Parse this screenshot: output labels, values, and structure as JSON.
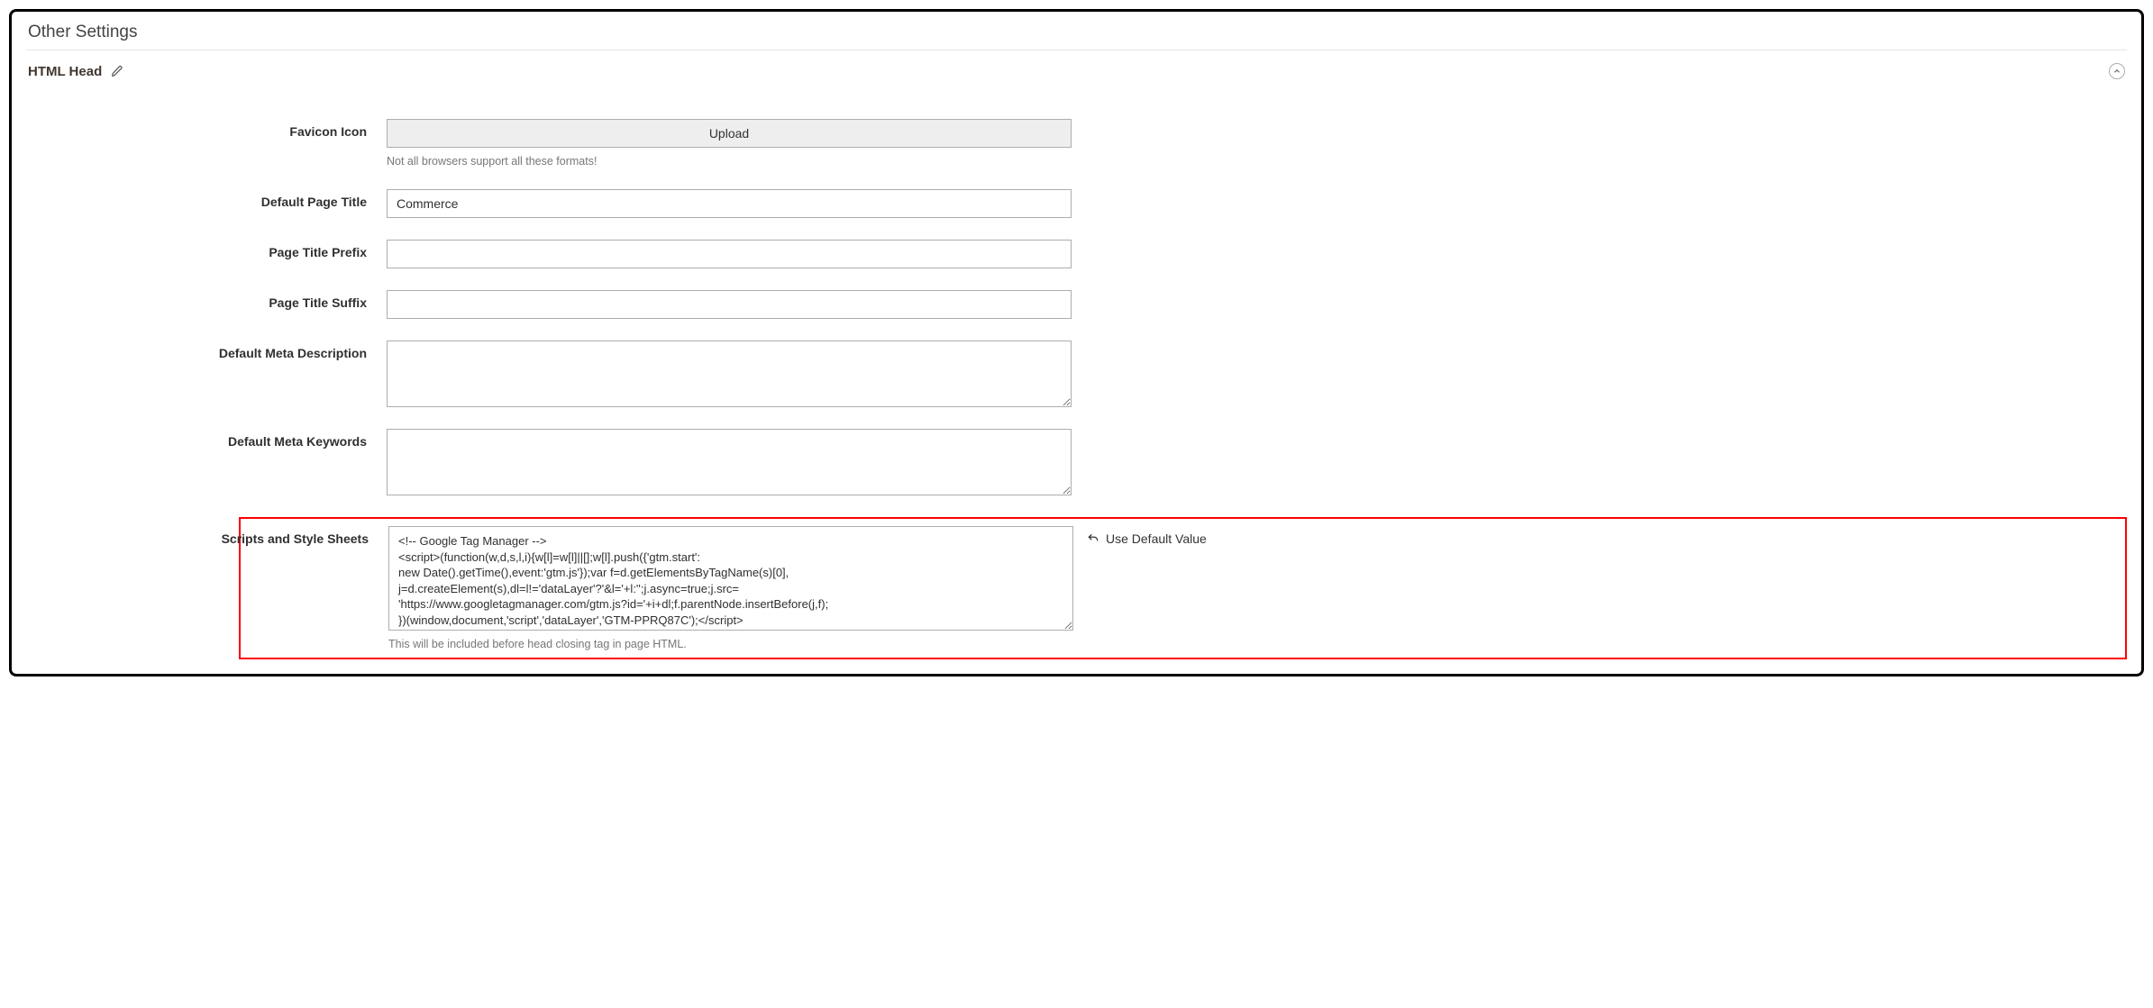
{
  "page_header": "Other Settings",
  "section": {
    "title": "HTML Head"
  },
  "fields": {
    "favicon": {
      "label": "Favicon Icon",
      "upload_button": "Upload",
      "hint": "Not all browsers support all these formats!"
    },
    "default_page_title": {
      "label": "Default Page Title",
      "value": "Commerce"
    },
    "page_title_prefix": {
      "label": "Page Title Prefix",
      "value": ""
    },
    "page_title_suffix": {
      "label": "Page Title Suffix",
      "value": ""
    },
    "default_meta_description": {
      "label": "Default Meta Description",
      "value": ""
    },
    "default_meta_keywords": {
      "label": "Default Meta Keywords",
      "value": ""
    },
    "scripts": {
      "label": "Scripts and Style Sheets",
      "value": "<!-- Google Tag Manager -->\n<script>(function(w,d,s,l,i){w[l]=w[l]||[];w[l].push({'gtm.start':\nnew Date().getTime(),event:'gtm.js'});var f=d.getElementsByTagName(s)[0],\nj=d.createElement(s),dl=l!='dataLayer'?'&l='+l:'';j.async=true;j.src=\n'https://www.googletagmanager.com/gtm.js?id='+i+dl;f.parentNode.insertBefore(j,f);\n})(window,document,'script','dataLayer','GTM-PPRQ87C');</script>\n<!-- End Google Tag Manager -->",
      "hint": "This will be included before head closing tag in page HTML.",
      "use_default_label": "Use Default Value"
    }
  }
}
